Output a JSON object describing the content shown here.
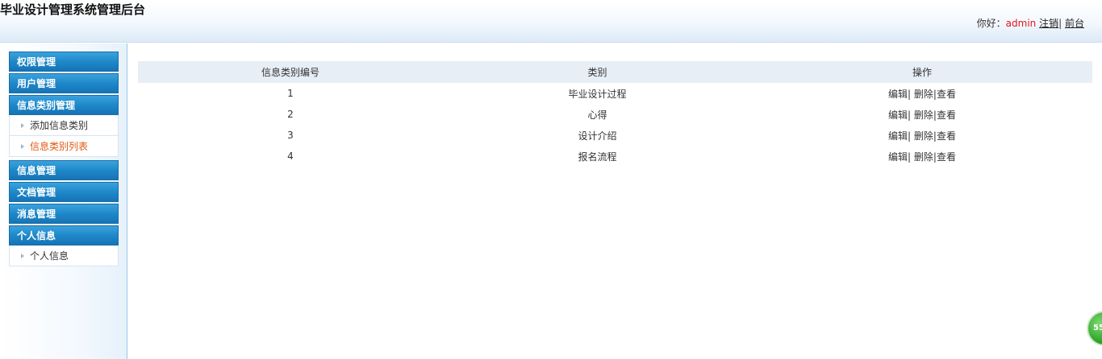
{
  "header": {
    "title": "毕业设计管理系统管理后台",
    "greeting": "你好：",
    "username": "admin",
    "logout_label": "注销",
    "separator": "|",
    "front_label": "前台"
  },
  "sidebar": {
    "groups": [
      {
        "label": "权限管理"
      },
      {
        "label": "用户管理"
      },
      {
        "label": "信息类别管理",
        "items": [
          {
            "label": "添加信息类别"
          },
          {
            "label": "信息类别列表"
          }
        ]
      },
      {
        "label": "信息管理"
      },
      {
        "label": "文档管理"
      },
      {
        "label": "消息管理"
      },
      {
        "label": "个人信息",
        "items": [
          {
            "label": "个人信息"
          }
        ]
      }
    ]
  },
  "table": {
    "headers": [
      "信息类别编号",
      "类别",
      "操作"
    ],
    "rows": [
      {
        "id": "1",
        "category": "毕业设计过程"
      },
      {
        "id": "2",
        "category": "心得"
      },
      {
        "id": "3",
        "category": "设计介绍"
      },
      {
        "id": "4",
        "category": "报名流程"
      }
    ],
    "ops": {
      "edit": "编辑|",
      "delete": "删除",
      "sep": "|",
      "view": "查看"
    }
  },
  "badge": {
    "text": "55"
  },
  "colors": {
    "accent": "#1f88c9",
    "username": "#e0161b",
    "active_menu": "#e05a14",
    "table_header": "#e8eef6"
  }
}
